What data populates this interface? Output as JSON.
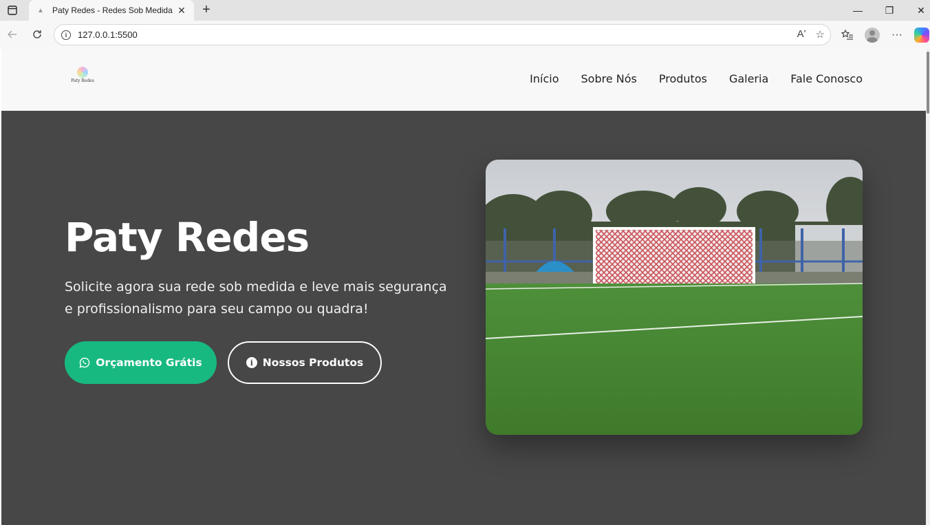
{
  "browser": {
    "tab_title": "Paty Redes - Redes Sob Medida",
    "tab_close": "✕",
    "new_tab": "+",
    "url": "127.0.0.1:5500",
    "window_controls": {
      "minimize": "—",
      "restore": "❐",
      "close": "✕"
    },
    "icons": [
      "sidebar-toggle-icon",
      "back-icon",
      "reload-icon",
      "info-icon",
      "read-aloud-icon",
      "favorite-star-icon",
      "favorites-icon",
      "profile-icon",
      "more-icon",
      "copilot-icon"
    ],
    "read_aloud": "Aʹ",
    "star": "☆",
    "favorites": "☆≡",
    "more": "···"
  },
  "site": {
    "logo_text": "Paty Redes",
    "nav": [
      "Início",
      "Sobre Nós",
      "Produtos",
      "Galeria",
      "Fale Conosco"
    ]
  },
  "hero": {
    "title": "Paty Redes",
    "subtitle": "Solicite agora sua rede sob medida e leve mais segurança e profissionalismo para seu campo ou quadra!",
    "primary_button": "Orçamento Grátis",
    "secondary_button": "Nossos Produtos",
    "image_icon": "soccer-goal-photo",
    "colors": {
      "background": "#474747",
      "accent": "#18b981",
      "text": "#ffffff"
    }
  }
}
